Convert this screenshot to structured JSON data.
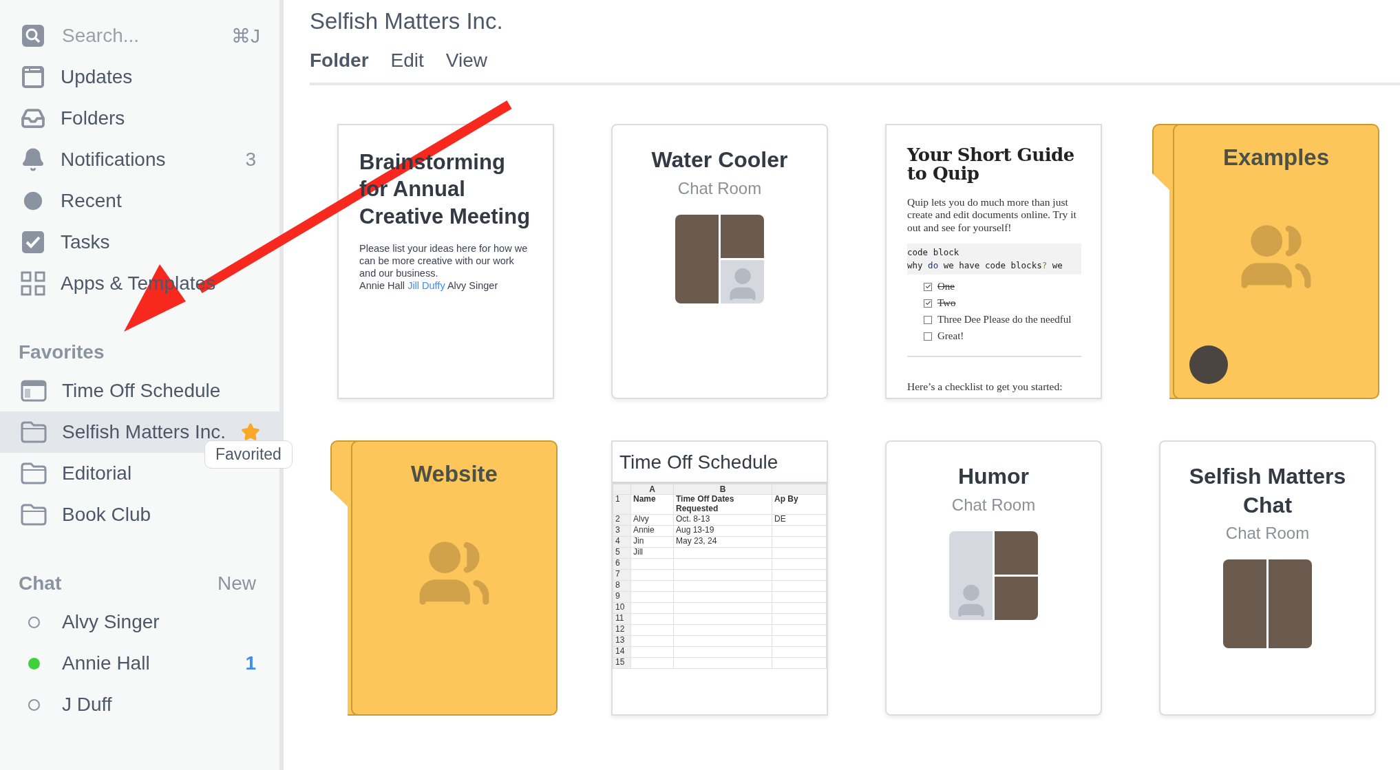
{
  "sidebar": {
    "search": {
      "placeholder": "Search...",
      "shortcut": "⌘J"
    },
    "nav": [
      {
        "kind": "updates",
        "label": "Updates"
      },
      {
        "kind": "folders",
        "label": "Folders"
      },
      {
        "kind": "notifications",
        "label": "Notifications",
        "count": "3"
      },
      {
        "kind": "recent",
        "label": "Recent"
      },
      {
        "kind": "tasks",
        "label": "Tasks"
      },
      {
        "kind": "apps",
        "label": "Apps & Templates"
      }
    ],
    "favorites": {
      "title": "Favorites",
      "items": [
        {
          "kind": "spreadsheet",
          "label": "Time Off Schedule",
          "selected": false,
          "starred": false
        },
        {
          "kind": "folder",
          "label": "Selfish Matters Inc.",
          "selected": true,
          "starred": true,
          "tooltip": "Favorited"
        },
        {
          "kind": "folder",
          "label": "Editorial",
          "selected": false,
          "starred": false
        },
        {
          "kind": "folder",
          "label": "Book Club",
          "selected": false,
          "starred": false
        }
      ]
    },
    "chat": {
      "title": "Chat",
      "action": "New",
      "people": [
        {
          "name": "Alvy Singer",
          "online": false
        },
        {
          "name": "Annie Hall",
          "online": true,
          "unread": "1"
        },
        {
          "name": "J Duff",
          "online": false
        }
      ]
    }
  },
  "header": {
    "title": "Selfish Matters Inc.",
    "menu": [
      {
        "label": "Folder",
        "selected": true
      },
      {
        "label": "Edit",
        "selected": false
      },
      {
        "label": "View",
        "selected": false
      }
    ]
  },
  "cards": [
    {
      "kind": "document",
      "title": "Brainstorming for Annual Creative Meeting",
      "body": "Please list your ideas here for how we can be more creative with our work and our business.",
      "people": [
        {
          "name": "Annie Hall",
          "mention": false
        },
        {
          "name": "Jill Duffy",
          "mention": true
        },
        {
          "name": "Alvy Singer",
          "mention": false
        }
      ]
    },
    {
      "kind": "chat",
      "title": "Water Cooler",
      "subtitle": "Chat Room",
      "members": [
        {
          "kind": "photo"
        },
        {
          "kind": "photo"
        },
        {
          "kind": "silhouette"
        }
      ]
    },
    {
      "kind": "guide",
      "title": "Your Short Guide to Quip",
      "body": "Quip lets you do much more than just create and edit documents online. Try it out and see for yourself!",
      "code": [
        [
          {
            "text": "code block",
            "kind": "plain"
          }
        ],
        [
          {
            "text": "why ",
            "kind": "plain"
          },
          {
            "text": "do",
            "kind": "keyword"
          },
          {
            "text": " we have code blocks",
            "kind": "plain"
          },
          {
            "text": "?",
            "kind": "punct"
          },
          {
            "text": " we",
            "kind": "plain"
          }
        ]
      ],
      "checklist": [
        {
          "text": "One",
          "checked": true
        },
        {
          "text": "Two",
          "checked": true
        },
        {
          "text": "Three Dee Please do the needful",
          "checked": false
        },
        {
          "text": "Great!",
          "checked": false
        }
      ],
      "footer": "Here’s a checklist to get you started:"
    },
    {
      "kind": "folder",
      "title": "Examples",
      "avatar": true
    },
    {
      "kind": "folder",
      "title": "Website",
      "avatar": false
    },
    {
      "kind": "spreadsheet",
      "title": "Time Off Schedule",
      "columns": [
        "",
        "A",
        "B",
        ""
      ],
      "rows": [
        [
          "1",
          "Name",
          "Time Off Dates Requested",
          "Ap By"
        ],
        [
          "2",
          "Alvy",
          "Oct. 8-13",
          "DE"
        ],
        [
          "3",
          "Annie",
          "Aug 13-19",
          ""
        ],
        [
          "4",
          "Jin",
          "May 23, 24",
          ""
        ],
        [
          "5",
          "Jill",
          "",
          ""
        ],
        [
          "6",
          "",
          "",
          ""
        ],
        [
          "7",
          "",
          "",
          ""
        ],
        [
          "8",
          "",
          "",
          ""
        ],
        [
          "9",
          "",
          "",
          ""
        ],
        [
          "10",
          "",
          "",
          ""
        ],
        [
          "11",
          "",
          "",
          ""
        ],
        [
          "12",
          "",
          "",
          ""
        ],
        [
          "13",
          "",
          "",
          ""
        ],
        [
          "14",
          "",
          "",
          ""
        ],
        [
          "15",
          "",
          "",
          ""
        ]
      ]
    },
    {
      "kind": "chat",
      "title": "Humor",
      "subtitle": "Chat Room",
      "members": [
        {
          "kind": "silhouette"
        },
        {
          "kind": "photo"
        },
        {
          "kind": "photo"
        }
      ]
    },
    {
      "kind": "chat",
      "title": "Selfish Matters Chat",
      "subtitle": "Chat Room",
      "members": [
        {
          "kind": "photo"
        },
        {
          "kind": "photo"
        }
      ]
    }
  ]
}
